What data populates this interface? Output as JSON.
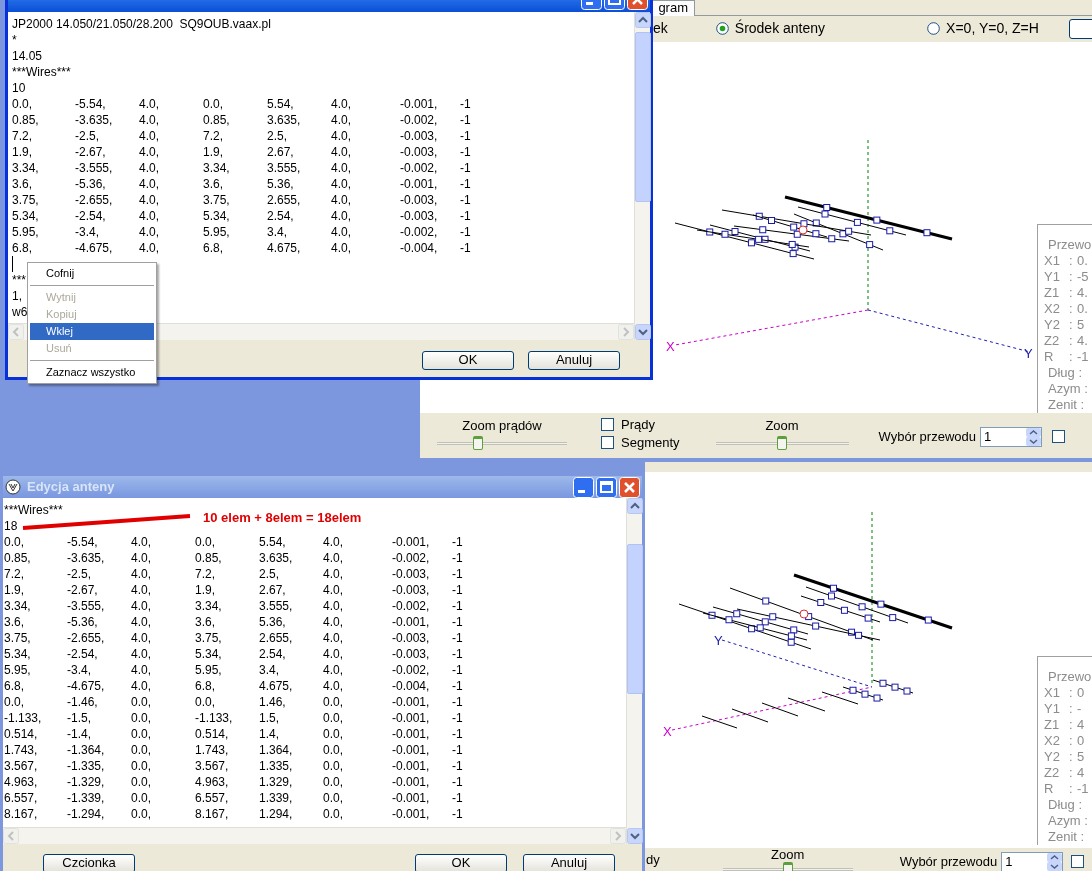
{
  "main_window": {
    "tab": "gram",
    "radios": [
      {
        "label": "ek"
      },
      {
        "label": "Środek anteny",
        "selected": true
      },
      {
        "label": "X=0, Y=0, Z=H",
        "selected": false
      }
    ],
    "axis_labels": [
      "X",
      "Y"
    ],
    "info_panel": {
      "title": "Przewo",
      "disabled": true,
      "rows": [
        {
          "label": "X1",
          "sep": ":",
          "value": "0."
        },
        {
          "label": "Y1",
          "sep": ":",
          "value": "-5"
        },
        {
          "label": "Z1",
          "sep": ":",
          "value": "4."
        },
        {
          "label": "X2",
          "sep": ":",
          "value": "0."
        },
        {
          "label": "Y2",
          "sep": ":",
          "value": "5"
        },
        {
          "label": "Z2",
          "sep": ":",
          "value": "4."
        },
        {
          "label": "R",
          "sep": ":",
          "value": "-1"
        },
        {
          "label": "Dług",
          "sep": ":"
        },
        {
          "label": "Azym",
          "sep": ":"
        },
        {
          "label": "Zenit",
          "sep": ":"
        }
      ]
    },
    "toolbar": {
      "current_zoom": {
        "label": "Zoom prądów",
        "level": 0.3
      },
      "checkboxes": [
        {
          "label": "Prądy",
          "checked": false
        },
        {
          "label": "Segmenty",
          "checked": false
        }
      ],
      "zoom": {
        "label": "Zoom",
        "level": 0.5
      },
      "wire_select": {
        "label": "Wybór przewodu",
        "value": "1"
      },
      "extra_checkbox": {
        "checked": false
      }
    }
  },
  "lower_window": {
    "axis_labels": [
      "Y",
      "X"
    ],
    "info_panel": {
      "title": "Przewo",
      "disabled": true,
      "rows": [
        {
          "label": "X1",
          "sep": ":",
          "value": "0"
        },
        {
          "label": "Y1",
          "sep": ":",
          "value": "-"
        },
        {
          "label": "Z1",
          "sep": ":",
          "value": "4"
        },
        {
          "label": "X2",
          "sep": ":",
          "value": "0"
        },
        {
          "label": "Y2",
          "sep": ":",
          "value": "5"
        },
        {
          "label": "Z2",
          "sep": ":",
          "value": "4"
        },
        {
          "label": "R",
          "sep": ":",
          "value": "-1"
        },
        {
          "label": "Dług",
          "sep": ":"
        },
        {
          "label": "Azym",
          "sep": ":"
        },
        {
          "label": "Zenit",
          "sep": ":"
        }
      ]
    },
    "toolbar": {
      "fragment": "dy",
      "zoom": {
        "label": "Zoom",
        "level": 0.5
      },
      "wire_select": {
        "label": "Wybór przewodu",
        "value": "1"
      },
      "extra_checkbox": {
        "checked": false
      }
    }
  },
  "top_dialog": {
    "active": true,
    "header": [
      "JP2000 14.050/21.050/28.200  SQ9OUB.vaax.pl",
      "*"
    ],
    "params": [
      "14.05",
      "***Wires***",
      "10"
    ],
    "rows": [
      [
        "0.0,",
        "-5.54,",
        "4.0,",
        "0.0,",
        "5.54,",
        "4.0,",
        "-0.001,",
        "-1"
      ],
      [
        "0.85,",
        "-3.635,",
        "4.0,",
        "0.85,",
        "3.635,",
        "4.0,",
        "-0.002,",
        "-1"
      ],
      [
        "7.2,",
        "-2.5,",
        "4.0,",
        "7.2,",
        "2.5,",
        "4.0,",
        "-0.003,",
        "-1"
      ],
      [
        "1.9,",
        "-2.67,",
        "4.0,",
        "1.9,",
        "2.67,",
        "4.0,",
        "-0.003,",
        "-1"
      ],
      [
        "3.34,",
        "-3.555,",
        "4.0,",
        "3.34,",
        "3.555,",
        "4.0,",
        "-0.002,",
        "-1"
      ],
      [
        "3.6,",
        "-5.36,",
        "4.0,",
        "3.6,",
        "5.36,",
        "4.0,",
        "-0.001,",
        "-1"
      ],
      [
        "3.75,",
        "-2.655,",
        "4.0,",
        "3.75,",
        "2.655,",
        "4.0,",
        "-0.003,",
        "-1"
      ],
      [
        "5.34,",
        "-2.54,",
        "4.0,",
        "5.34,",
        "2.54,",
        "4.0,",
        "-0.003,",
        "-1"
      ],
      [
        "5.95,",
        "-3.4,",
        "4.0,",
        "5.95,",
        "3.4,",
        "4.0,",
        "-0.002,",
        "-1"
      ],
      [
        "6.8,",
        "-4.675,",
        "4.0,",
        "6.8,",
        "4.675,",
        "4.0,",
        "-0.004,",
        "-1"
      ]
    ],
    "tail": [
      "***",
      "1,",
      "w6"
    ],
    "buttons": [
      "OK",
      "Anuluj"
    ]
  },
  "context_menu": [
    {
      "kind": "item",
      "label": "Cofnij",
      "disabled": false,
      "selected": false
    },
    {
      "kind": "separator"
    },
    {
      "kind": "item",
      "label": "Wytnij",
      "disabled": true,
      "selected": false
    },
    {
      "kind": "item",
      "label": "Kopiuj",
      "disabled": true,
      "selected": false
    },
    {
      "kind": "item",
      "label": "Wklej",
      "disabled": false,
      "selected": true
    },
    {
      "kind": "item",
      "label": "Usuń",
      "disabled": true,
      "selected": false
    },
    {
      "kind": "separator"
    },
    {
      "kind": "item",
      "label": "Zaznacz wszystko",
      "disabled": false,
      "selected": false
    }
  ],
  "bottom_dialog": {
    "title": "Edycja anteny",
    "active": false,
    "params": [
      "***Wires***",
      "18"
    ],
    "annotation": "10 elem + 8elem = 18elem",
    "rows": [
      [
        "0.0,",
        "-5.54,",
        "4.0,",
        "0.0,",
        "5.54,",
        "4.0,",
        "-0.001,",
        "-1"
      ],
      [
        "0.85,",
        "-3.635,",
        "4.0,",
        "0.85,",
        "3.635,",
        "4.0,",
        "-0.002,",
        "-1"
      ],
      [
        "7.2,",
        "-2.5,",
        "4.0,",
        "7.2,",
        "2.5,",
        "4.0,",
        "-0.003,",
        "-1"
      ],
      [
        "1.9,",
        "-2.67,",
        "4.0,",
        "1.9,",
        "2.67,",
        "4.0,",
        "-0.003,",
        "-1"
      ],
      [
        "3.34,",
        "-3.555,",
        "4.0,",
        "3.34,",
        "3.555,",
        "4.0,",
        "-0.002,",
        "-1"
      ],
      [
        "3.6,",
        "-5.36,",
        "4.0,",
        "3.6,",
        "5.36,",
        "4.0,",
        "-0.001,",
        "-1"
      ],
      [
        "3.75,",
        "-2.655,",
        "4.0,",
        "3.75,",
        "2.655,",
        "4.0,",
        "-0.003,",
        "-1"
      ],
      [
        "5.34,",
        "-2.54,",
        "4.0,",
        "5.34,",
        "2.54,",
        "4.0,",
        "-0.003,",
        "-1"
      ],
      [
        "5.95,",
        "-3.4,",
        "4.0,",
        "5.95,",
        "3.4,",
        "4.0,",
        "-0.002,",
        "-1"
      ],
      [
        "6.8,",
        "-4.675,",
        "4.0,",
        "6.8,",
        "4.675,",
        "4.0,",
        "-0.004,",
        "-1"
      ],
      [
        "0.0,",
        "-1.46,",
        "0.0,",
        "0.0,",
        "1.46,",
        "0.0,",
        "-0.001,",
        "-1"
      ],
      [
        "-1.133,",
        "-1.5,",
        "0.0,",
        "-1.133,",
        "1.5,",
        "0.0,",
        "-0.001,",
        "-1"
      ],
      [
        "0.514,",
        "-1.4,",
        "0.0,",
        "0.514,",
        "1.4,",
        "0.0,",
        "-0.001,",
        "-1"
      ],
      [
        "1.743,",
        "-1.364,",
        "0.0,",
        "1.743,",
        "1.364,",
        "0.0,",
        "-0.001,",
        "-1"
      ],
      [
        "3.567,",
        "-1.335,",
        "0.0,",
        "3.567,",
        "1.335,",
        "0.0,",
        "-0.001,",
        "-1"
      ],
      [
        "4.963,",
        "-1.329,",
        "0.0,",
        "4.963,",
        "1.329,",
        "0.0,",
        "-0.001,",
        "-1"
      ],
      [
        "6.557,",
        "-1.339,",
        "0.0,",
        "6.557,",
        "1.339,",
        "0.0,",
        "-0.001,",
        "-1"
      ],
      [
        "8.167,",
        "-1.294,",
        "0.0,",
        "8.167,",
        "1.294,",
        "0.0,",
        "-0.001,",
        "-1"
      ]
    ],
    "buttons": [
      "Czcionka",
      "OK",
      "Anuluj"
    ]
  }
}
